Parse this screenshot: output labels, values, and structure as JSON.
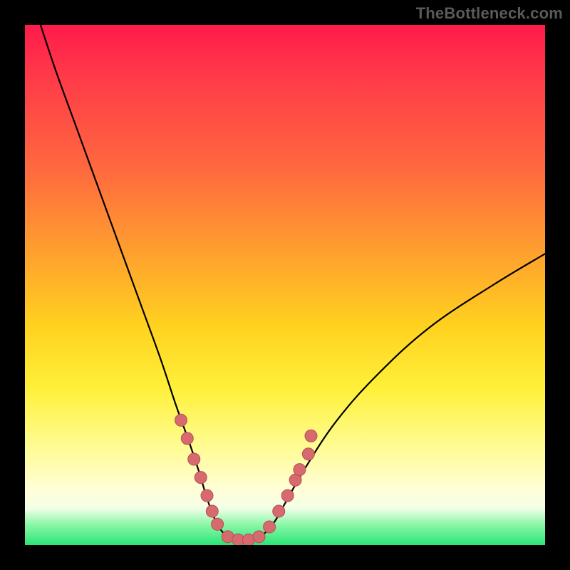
{
  "watermark": {
    "text": "TheBottleneck.com"
  },
  "chart_data": {
    "type": "line",
    "title": "",
    "xlabel": "",
    "ylabel": "",
    "xlim": [
      0,
      100
    ],
    "ylim": [
      0,
      100
    ],
    "legend": false,
    "grid": false,
    "series": [
      {
        "name": "bottleneck-curve",
        "x": [
          3,
          6,
          10,
          14,
          18,
          22,
          26,
          29,
          31.5,
          33.5,
          35,
          36.5,
          38,
          40,
          42,
          44,
          46,
          48,
          50,
          54,
          60,
          68,
          78,
          90,
          100
        ],
        "y": [
          100,
          91,
          80,
          69,
          58,
          47,
          36,
          27,
          20,
          14,
          9,
          5,
          2.5,
          1.2,
          1.0,
          1.2,
          2.2,
          4.5,
          8,
          15,
          24,
          33,
          42,
          50,
          56
        ]
      }
    ],
    "markers": [
      {
        "series": "bottleneck-curve",
        "x": 30.0,
        "y": 24.0
      },
      {
        "series": "bottleneck-curve",
        "x": 31.2,
        "y": 20.5
      },
      {
        "series": "bottleneck-curve",
        "x": 32.5,
        "y": 16.5
      },
      {
        "series": "bottleneck-curve",
        "x": 33.8,
        "y": 13.0
      },
      {
        "series": "bottleneck-curve",
        "x": 35.0,
        "y": 9.5
      },
      {
        "series": "bottleneck-curve",
        "x": 36.0,
        "y": 6.5
      },
      {
        "series": "bottleneck-curve",
        "x": 37.0,
        "y": 4.0
      },
      {
        "series": "bottleneck-curve",
        "x": 39.0,
        "y": 1.6
      },
      {
        "series": "bottleneck-curve",
        "x": 41.0,
        "y": 1.0
      },
      {
        "series": "bottleneck-curve",
        "x": 43.0,
        "y": 1.0
      },
      {
        "series": "bottleneck-curve",
        "x": 45.0,
        "y": 1.6
      },
      {
        "series": "bottleneck-curve",
        "x": 47.0,
        "y": 3.5
      },
      {
        "series": "bottleneck-curve",
        "x": 48.8,
        "y": 6.5
      },
      {
        "series": "bottleneck-curve",
        "x": 50.5,
        "y": 9.5
      },
      {
        "series": "bottleneck-curve",
        "x": 52.0,
        "y": 12.5
      },
      {
        "series": "bottleneck-curve",
        "x": 52.8,
        "y": 14.5
      },
      {
        "series": "bottleneck-curve",
        "x": 54.5,
        "y": 17.5
      },
      {
        "series": "bottleneck-curve",
        "x": 55.0,
        "y": 21.0
      }
    ],
    "colors": {
      "curve_stroke": "#000000",
      "marker_fill": "#d66a6f",
      "marker_stroke": "#b84e53",
      "gradient_top": "#ff1b4a",
      "gradient_mid": "#ffd21f",
      "gradient_bottom": "#2be577"
    }
  }
}
